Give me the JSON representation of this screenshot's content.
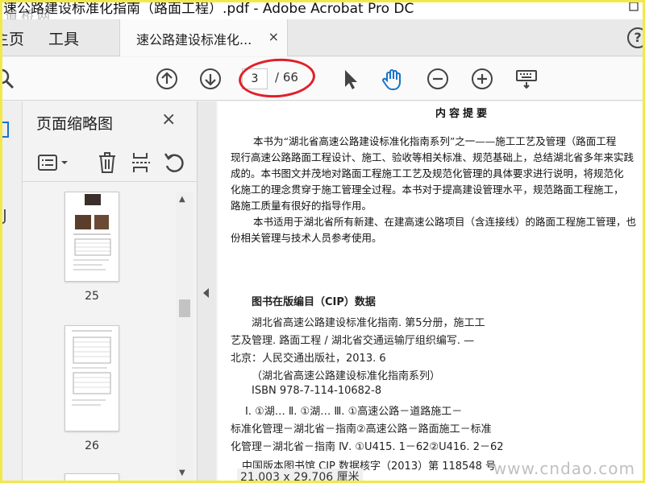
{
  "window": {
    "title": "速公路建设标准化指南（路面工程）.pdf - Adobe Acrobat Pro DC",
    "watermark_top": "道桥网"
  },
  "tabs": {
    "home_label": "主页",
    "tools_label": "工具",
    "document_tab_label": "速公路建设标准化...",
    "close_glyph": "×",
    "help_glyph": "?"
  },
  "toolbar": {
    "current_page": "3",
    "page_total": "/ 66",
    "icons": [
      "search-icon",
      "page-up-icon",
      "page-down-icon",
      "select-arrow-icon",
      "hand-icon",
      "zoom-out-icon",
      "zoom-in-icon",
      "keyboard-icon"
    ]
  },
  "thumbnail_panel": {
    "title": "页面缩略图",
    "close_glyph": "×",
    "thumbnails": [
      {
        "page_label": "25"
      },
      {
        "page_label": "26"
      }
    ]
  },
  "document": {
    "heading": "内容提要",
    "summary_lines": [
      "本书为“湖北省高速公路建设标准化指南系列”之一——施工工艺及管理（路面工程",
      "现行高速公路路面工程设计、施工、验收等相关标准、规范基础上，总结湖北省多年来实践",
      "成的。本书图文并茂地对路面工程施工工艺及规范化管理的具体要求进行说明，将规范化",
      "化施工的理念贯穿于施工管理全过程。本书对于提高建设管理水平，规范路面工程施工，",
      "路施工质量有很好的指导作用。",
      "本书适用于湖北省所有新建、在建高速公路项目（含连接线）的路面工程施工管理，也",
      "份相关管理与技术人员参考使用。"
    ],
    "cip_title": "图书在版编目（CIP）数据",
    "cip_lines": [
      "湖北省高速公路建设标准化指南. 第5分册，施工工",
      "艺及管理. 路面工程 / 湖北省交通运输厅组织编写. —",
      "北京：人民交通出版社，2013. 6",
      "（湖北省高速公路建设标准化指南系列）",
      "ISBN 978-7-114-10682-8",
      "Ⅰ. ①湖… Ⅱ. ①湖… Ⅲ. ①高速公路－道路施工－",
      "标准化管理－湖北省－指南②高速公路－路面施工－标准",
      "化管理－湖北省－指南 Ⅳ. ①U415. 1－62②U416. 2－62"
    ],
    "cip_footer": "中国版本图书馆 CIP 数据核字（2013）第 118548 号",
    "page_size": "21.003 x 29.706 厘米",
    "watermark_site": "www.cndao.com"
  }
}
